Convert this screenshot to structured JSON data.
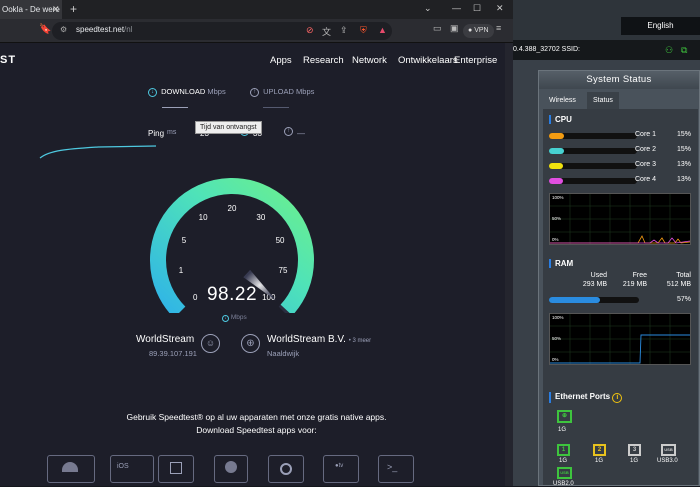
{
  "browser": {
    "tab_title": "Ookla - De were",
    "url_host": "speedtest.net",
    "url_path": "/nl",
    "vpn_label": "VPN"
  },
  "site": {
    "logo": "ST",
    "nav": [
      "Apps",
      "Research",
      "Network",
      "Ontwikkelaars",
      "Enterprise"
    ]
  },
  "test": {
    "download_label": "DOWNLOAD",
    "upload_label": "UPLOAD",
    "unit_label": "Mbps",
    "ping_label": "Ping",
    "ping_unit": "ms",
    "ping_value": "23",
    "download_latency": "33",
    "upload_latency": "—",
    "tooltip": "Tijd van ontvangst",
    "gauge_ticks": [
      "0",
      "1",
      "5",
      "10",
      "20",
      "30",
      "50",
      "75",
      "100"
    ],
    "gauge_max": 100,
    "speed_value": "98.22",
    "speed_numeric": 98.22,
    "speed_unit": "Mbps"
  },
  "servers": {
    "isp_name": "WorldStream",
    "isp_ip": "89.39.107.191",
    "host_name": "WorldStream B.V.",
    "host_more": "• 3 meer",
    "host_location": "Naaldwijk"
  },
  "promo": {
    "line1": "Gebruik Speedtest® op al uw apparaten met onze gratis native apps.",
    "line2": "Download Speedtest apps voor:"
  },
  "router": {
    "language_button": "English",
    "firmware_text": "0.4.388_32702  SSID:",
    "panel_title": "System Status",
    "tabs": [
      "Wireless",
      "Status"
    ],
    "cpu_title": "CPU",
    "cores": [
      {
        "label": "Core 1",
        "pct": "15%",
        "value": 15,
        "color": "#f39c12"
      },
      {
        "label": "Core 2",
        "pct": "15%",
        "value": 15,
        "color": "#47d1d1"
      },
      {
        "label": "Core 3",
        "pct": "13%",
        "value": 13,
        "color": "#f1e20f"
      },
      {
        "label": "Core 4",
        "pct": "13%",
        "value": 13,
        "color": "#e14fe1"
      }
    ],
    "graph_labels": [
      "100%",
      "50%",
      "0%"
    ],
    "ram_title": "RAM",
    "ram_headers": [
      "Used",
      "Free",
      "Total"
    ],
    "ram_values": [
      "293 MB",
      "219 MB",
      "512 MB"
    ],
    "ram_pct": "57%",
    "ram_value": 57,
    "eth_title": "Ethernet Ports",
    "wan_speed": "1G",
    "lan_ports": [
      {
        "num": "1",
        "speed": "1G",
        "color": "#3ec43e"
      },
      {
        "num": "2",
        "speed": "1G",
        "color": "#e8c21e"
      },
      {
        "num": "3",
        "speed": "1G",
        "color": "#cccccc"
      },
      {
        "num": "USB",
        "speed": "USB3.0",
        "color": "#cccccc"
      }
    ],
    "usb2_label": "USB2.0"
  }
}
